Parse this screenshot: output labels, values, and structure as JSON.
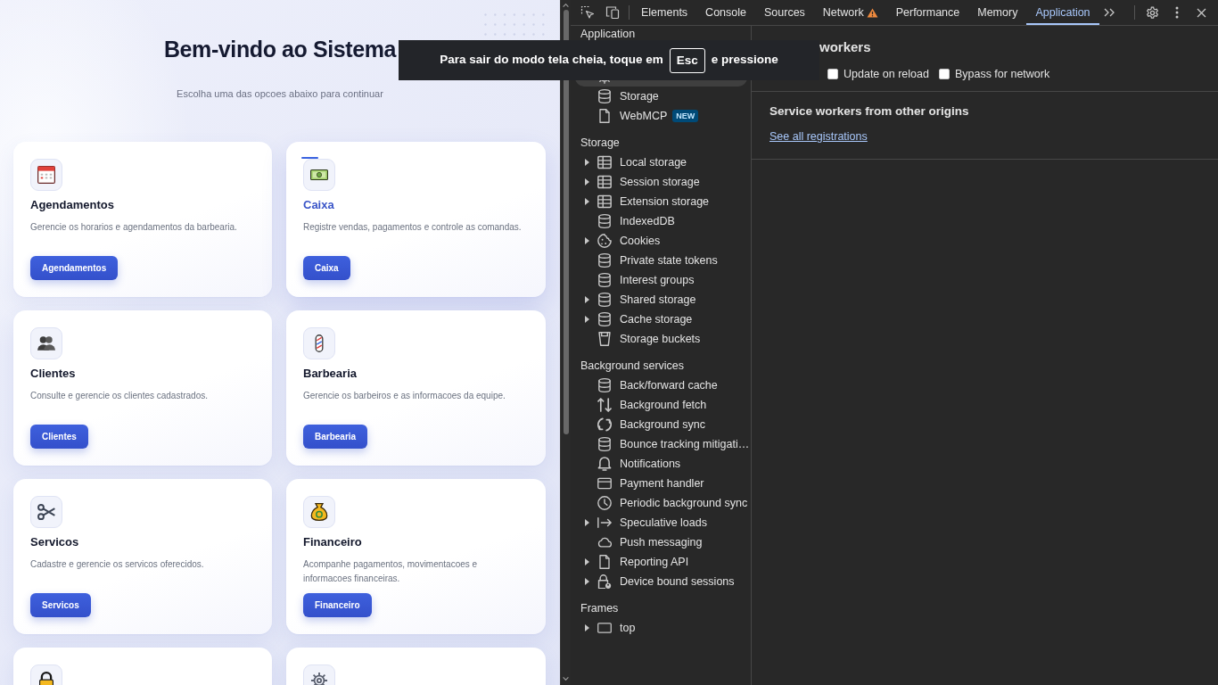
{
  "page": {
    "title": "Bem-vindo ao Sistema",
    "subtitle": "Escolha uma das opcoes abaixo para continuar",
    "cards": [
      {
        "title": "Agendamentos",
        "description": "Gerencie os horarios e agendamentos da barbearia.",
        "button": "Agendamentos",
        "hovered": false
      },
      {
        "title": "Caixa",
        "description": "Registre vendas, pagamentos e controle as comandas.",
        "button": "Caixa",
        "hovered": true
      },
      {
        "title": "Clientes",
        "description": "Consulte e gerencie os clientes cadastrados.",
        "button": "Clientes",
        "hovered": false
      },
      {
        "title": "Barbearia",
        "description": "Gerencie os barbeiros e as informacoes da equipe.",
        "button": "Barbearia",
        "hovered": false
      },
      {
        "title": "Servicos",
        "description": "Cadastre e gerencie os servicos oferecidos.",
        "button": "Servicos",
        "hovered": false
      },
      {
        "title": "Financeiro",
        "description": "Acompanhe pagamentos, movimentacoes e informacoes financeiras.",
        "button": "Financeiro",
        "hovered": false
      },
      {
        "hovered": false
      },
      {
        "hovered": false
      }
    ]
  },
  "devtools": {
    "tabs": [
      {
        "label": "Elements",
        "selected": false,
        "warning": false
      },
      {
        "label": "Console",
        "selected": false,
        "warning": false
      },
      {
        "label": "Sources",
        "selected": false,
        "warning": false
      },
      {
        "label": "Network",
        "selected": false,
        "warning": true
      },
      {
        "label": "Performance",
        "selected": false,
        "warning": false
      },
      {
        "label": "Memory",
        "selected": false,
        "warning": false
      },
      {
        "label": "Application",
        "selected": true,
        "warning": false
      }
    ],
    "sidebar": {
      "sections": [
        {
          "title": "Application",
          "items": [
            {
              "selected": true
            },
            {
              "label": "Storage",
              "selected": false
            },
            {
              "label": "WebMCP",
              "badge": "NEW",
              "selected": false
            }
          ]
        },
        {
          "title": "Storage",
          "items": [
            {
              "label": "Local storage",
              "selected": false,
              "expanded": false
            },
            {
              "label": "Session storage",
              "selected": false,
              "expanded": false
            },
            {
              "label": "Extension storage",
              "selected": false,
              "expanded": false
            },
            {
              "label": "IndexedDB",
              "selected": false
            },
            {
              "label": "Cookies",
              "selected": false,
              "expanded": false
            },
            {
              "label": "Private state tokens",
              "selected": false
            },
            {
              "label": "Interest groups",
              "selected": false
            },
            {
              "label": "Shared storage",
              "selected": false,
              "expanded": false
            },
            {
              "label": "Cache storage",
              "selected": false,
              "expanded": false
            },
            {
              "label": "Storage buckets",
              "selected": false
            }
          ]
        },
        {
          "title": "Background services",
          "items": [
            {
              "label": "Back/forward cache",
              "selected": false
            },
            {
              "label": "Background fetch",
              "selected": false
            },
            {
              "label": "Background sync",
              "selected": false
            },
            {
              "label": "Bounce tracking mitigati…",
              "selected": false
            },
            {
              "label": "Notifications",
              "selected": false
            },
            {
              "label": "Payment handler",
              "selected": false
            },
            {
              "label": "Periodic background sync",
              "selected": false
            },
            {
              "label": "Speculative loads",
              "selected": false,
              "expanded": false
            },
            {
              "label": "Push messaging",
              "selected": false
            },
            {
              "label": "Reporting API",
              "selected": false,
              "expanded": false
            },
            {
              "label": "Device bound sessions",
              "selected": false,
              "expanded": false
            }
          ]
        },
        {
          "title": "Frames",
          "items": [
            {
              "label": "top",
              "selected": false,
              "expanded": false
            }
          ]
        }
      ]
    },
    "main": {
      "heading": "workers",
      "checkboxes": [
        {
          "label": "Update on reload",
          "checked": false
        },
        {
          "label": "Bypass for network",
          "checked": false
        }
      ],
      "other_origins": {
        "heading": "Service workers from other origins",
        "link": "See all registrations"
      }
    }
  },
  "fullscreen_notice": {
    "text_before": "Para sair do modo tela cheia, toque em",
    "key": "Esc",
    "text_after": "e pressione"
  }
}
